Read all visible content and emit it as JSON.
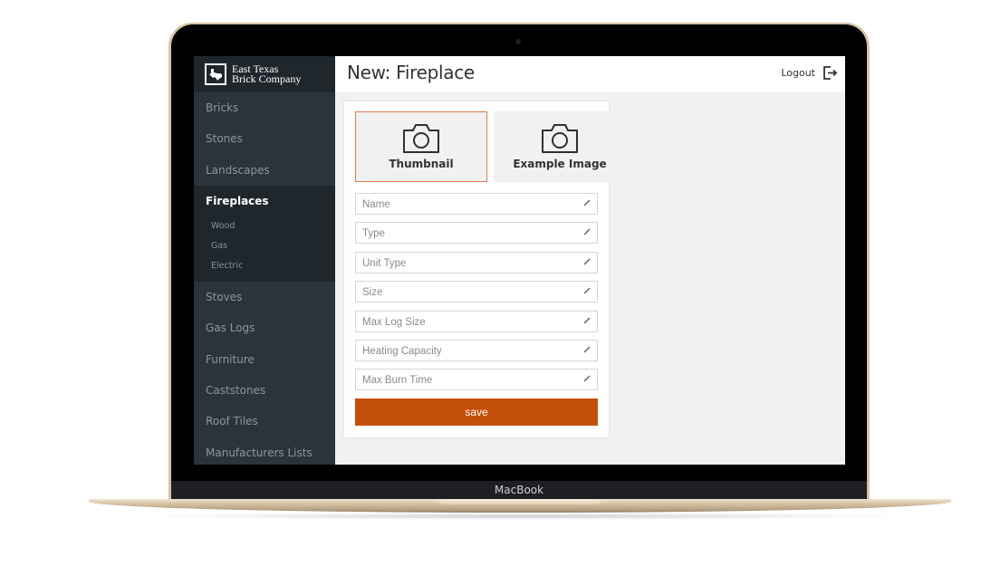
{
  "device": {
    "brand_label": "MacBook"
  },
  "app": {
    "logo": {
      "line1": "East Texas",
      "line2": "Brick Company",
      "icon": "texas-map-icon"
    }
  },
  "sidebar": {
    "items_top": [
      {
        "label": "Bricks"
      },
      {
        "label": "Stones"
      },
      {
        "label": "Landscapes"
      }
    ],
    "active": {
      "label": "Fireplaces",
      "subitems": [
        {
          "label": "Wood"
        },
        {
          "label": "Gas"
        },
        {
          "label": "Electric"
        }
      ]
    },
    "items_bottom": [
      {
        "label": "Stoves"
      },
      {
        "label": "Gas Logs"
      },
      {
        "label": "Furniture"
      },
      {
        "label": "Caststones"
      },
      {
        "label": "Roof Tiles"
      },
      {
        "label": "Manufacturers Lists"
      }
    ]
  },
  "header": {
    "title": "New: Fireplace",
    "logout_label": "Logout",
    "logout_icon": "logout-icon"
  },
  "form": {
    "image_tiles": [
      {
        "label": "Thumbnail",
        "icon": "camera-icon",
        "selected": true
      },
      {
        "label": "Example Image",
        "icon": "camera-icon",
        "selected": false
      }
    ],
    "fields": [
      {
        "placeholder": "Name",
        "value": ""
      },
      {
        "placeholder": "Type",
        "value": ""
      },
      {
        "placeholder": "Unit Type",
        "value": ""
      },
      {
        "placeholder": "Size",
        "value": ""
      },
      {
        "placeholder": "Max Log Size",
        "value": ""
      },
      {
        "placeholder": "Heating Capacity",
        "value": ""
      },
      {
        "placeholder": "Max Burn Time",
        "value": ""
      }
    ],
    "save_label": "save"
  },
  "colors": {
    "accent": "#c44f0a",
    "selected_border": "#e07a4f",
    "sidebar_bg": "#2a343b",
    "sidebar_active_bg": "#1f272d"
  }
}
